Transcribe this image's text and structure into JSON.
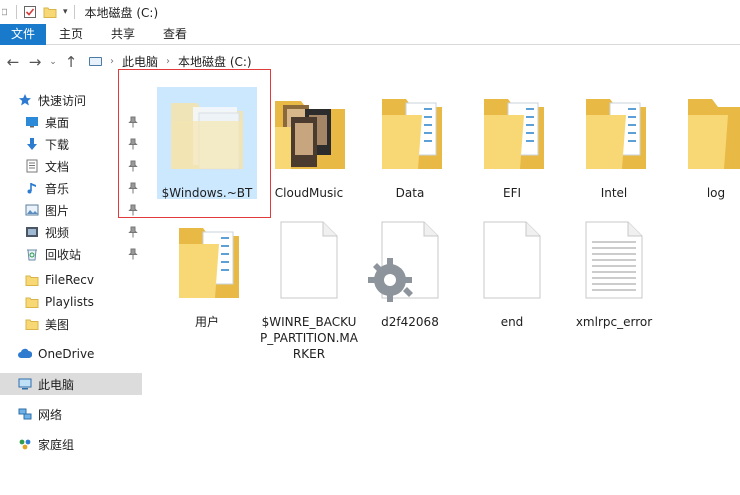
{
  "window": {
    "title": "本地磁盘 (C:)"
  },
  "ribbon": {
    "tabs": [
      "文件",
      "主页",
      "共享",
      "查看"
    ]
  },
  "address": {
    "crumbs": [
      "此电脑",
      "本地磁盘 (C:)"
    ]
  },
  "sidebar": {
    "quick_access": "快速访问",
    "items": [
      {
        "label": "桌面",
        "pinned": true
      },
      {
        "label": "下载",
        "pinned": true
      },
      {
        "label": "文档",
        "pinned": true
      },
      {
        "label": "音乐",
        "pinned": true
      },
      {
        "label": "图片",
        "pinned": true
      },
      {
        "label": "视频",
        "pinned": true
      },
      {
        "label": "回收站",
        "pinned": true
      },
      {
        "label": "FileRecv",
        "pinned": false
      },
      {
        "label": "Playlists",
        "pinned": false
      },
      {
        "label": "美图",
        "pinned": false
      }
    ],
    "onedrive": "OneDrive",
    "this_pc": "此电脑",
    "network": "网络",
    "homegroup": "家庭组"
  },
  "files": [
    {
      "name": "$Windows.~BT",
      "type": "folder-hidden"
    },
    {
      "name": "CloudMusic",
      "type": "folder-images"
    },
    {
      "name": "Data",
      "type": "folder"
    },
    {
      "name": "EFI",
      "type": "folder"
    },
    {
      "name": "Intel",
      "type": "folder"
    },
    {
      "name": "log",
      "type": "folder-empty"
    },
    {
      "name": "用户",
      "type": "folder"
    },
    {
      "name": "$WINRE_BACKUP_PARTITION.MARKER",
      "type": "file"
    },
    {
      "name": "d2f42068",
      "type": "system-file"
    },
    {
      "name": "end",
      "type": "file"
    },
    {
      "name": "xmlrpc_error",
      "type": "text-file"
    }
  ],
  "colors": {
    "file_tab": "#1979ca",
    "selection": "#cce8ff",
    "highlight_box": "#e23b3b",
    "folder": "#f8d775"
  }
}
